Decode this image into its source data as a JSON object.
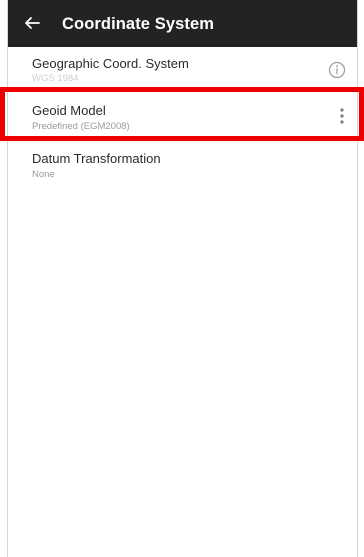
{
  "appbar": {
    "title": "Coordinate System",
    "back_icon": "arrow-back-icon"
  },
  "rows": [
    {
      "title": "Geographic Coord. System",
      "subtitle": "WGS 1984",
      "icon": "info-icon"
    },
    {
      "title": "Geoid Model",
      "subtitle": "Predefined (EGM2008)",
      "icon": "more-vert-icon"
    },
    {
      "title": "Datum Transformation",
      "subtitle": "None"
    }
  ],
  "colors": {
    "appbar_bg": "#232323",
    "highlight_border": "#ee0000",
    "text_primary": "#2a2a2a",
    "text_secondary": "#9a9a9a"
  }
}
